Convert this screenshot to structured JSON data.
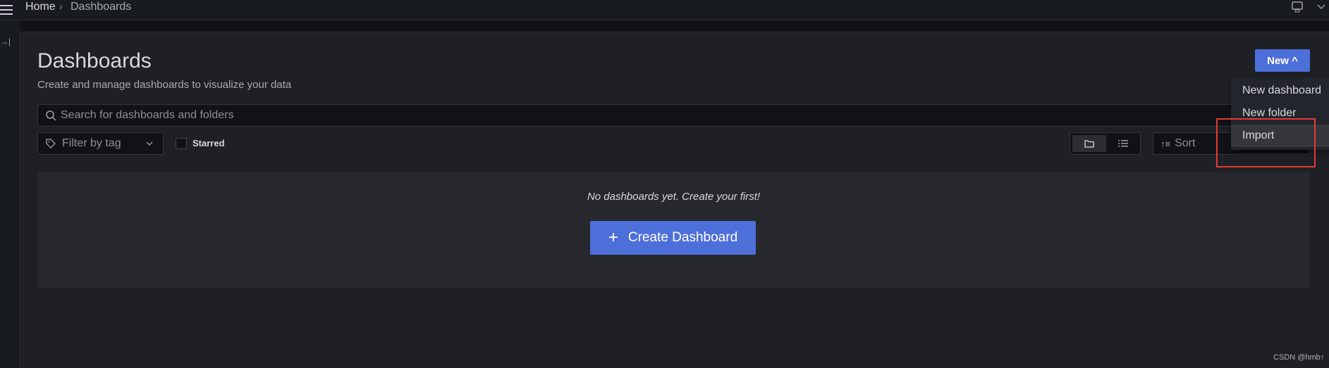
{
  "topbar": {
    "breadcrumb": [
      "Home",
      "Dashboards"
    ],
    "icons": [
      "menu-icon",
      "monitor-icon",
      "chevron-down-icon"
    ]
  },
  "page": {
    "title": "Dashboards",
    "subtitle": "Create and manage dashboards to visualize your data"
  },
  "new_button": {
    "label": "New ^"
  },
  "new_menu": {
    "items": [
      {
        "label": "New dashboard"
      },
      {
        "label": "New folder"
      },
      {
        "label": "Import",
        "highlighted": true
      }
    ]
  },
  "search": {
    "placeholder": "Search for dashboards and folders"
  },
  "filter": {
    "tag_placeholder": "Filter by tag",
    "starred_label": "Starred",
    "starred": false
  },
  "sort": {
    "placeholder": "Sort"
  },
  "view_toggle": {
    "selected": "folder"
  },
  "empty_state": {
    "message": "No dashboards yet. Create your first!",
    "button": "Create Dashboard"
  },
  "watermark": "CSDN @hmb↑",
  "colors": {
    "accent": "#4d6fd9",
    "highlight_box": "#e53935"
  }
}
